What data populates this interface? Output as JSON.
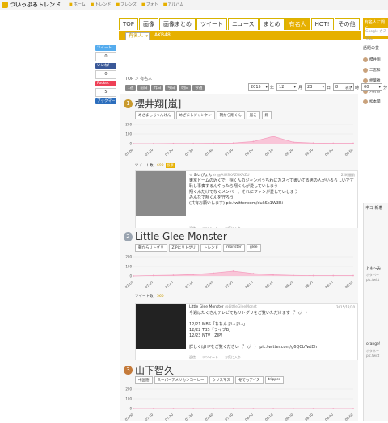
{
  "site": {
    "logo": "ついっぷるトレンド"
  },
  "top_nav": [
    {
      "icon": "home-icon",
      "label": "ホーム"
    },
    {
      "icon": "trend-icon",
      "label": "トレンド"
    },
    {
      "icon": "friends-icon",
      "label": "フレンズ"
    },
    {
      "icon": "photo-icon",
      "label": "フォト"
    },
    {
      "icon": "album-icon",
      "label": "アルバム"
    }
  ],
  "main_nav": {
    "tabs": [
      "TOP",
      "画像",
      "画像まとめ",
      "ツイート",
      "ニュース",
      "まとめ",
      "有名人",
      "HOT!",
      "その他"
    ],
    "active": "有名人",
    "sub": [
      "有名人",
      "AKB48"
    ]
  },
  "social": {
    "tweet": "ツイート",
    "tweet_count": "0",
    "like": "いいね！",
    "like_count": "0",
    "pocket": "Pocket",
    "pocket_count": "5",
    "bookmark": "ブックマーク"
  },
  "sidebar": {
    "search_title": "有名人に聞く",
    "search_placeholder": "Google カスタム",
    "ranking_title": "話題の芸",
    "ranking": [
      "櫻井翔",
      "二宮和",
      "相葉雅",
      "大野智",
      "松本潤"
    ],
    "news_title": "ネコ 新着",
    "news_users": [
      "とも〜み",
      "orange!"
    ],
    "news_texts": [
      "ボタバー",
      "pic.twitt",
      "ボタネー",
      "pic.twitt"
    ]
  },
  "breadcrumb": "TOP ＞ 有名人",
  "date_buttons": [
    "1週",
    "前日",
    "昨日",
    "今日",
    "明日",
    "今週"
  ],
  "date_select": {
    "year": "2015",
    "year_unit": "年",
    "month": "12",
    "month_unit": "月",
    "day": "23",
    "day_unit": "日",
    "hour": "8",
    "hour_unit": "時",
    "minute": "00",
    "minute_unit": "分",
    "show": "表示"
  },
  "cards": [
    {
      "rank": "1",
      "name": "櫻井翔[嵐]",
      "tags": [
        "めざましじゃんけん",
        "めざましジャンケン",
        "朝から翔くん",
        "嵐こ",
        "翔"
      ],
      "tweet_count_label": "ツイート数：",
      "tweet_count": "690",
      "tweet_count_pill": "投票",
      "tweet": {
        "user": "☆ あいぴょん ☆",
        "handle": "@AIUSKAZUKAZU",
        "date": "22時間前",
        "text": "東京ドームの近くで、翔くんのジャンボうちわにカスって書いてる男の人がいるらしいです\n恥し事奏するんやったら翔くんが愛していしまう\n翔くんだけでなくメンバー、それにファンが愛していしまう\nみんなで翔くんを守ろう\n(共有お願いします) pic.twitter.com/dukSk1W3Ri",
        "acts": [
          "返信",
          "リツイート",
          "お気に入り"
        ]
      }
    },
    {
      "rank": "2",
      "name": "Little Glee Monster",
      "tags": [
        "朝からリトグリ",
        "ZIPにリトグリ",
        "トレンド",
        "monster",
        "glee"
      ],
      "tweet_count_label": "ツイート数：",
      "tweet_count": "560",
      "tweet": {
        "user": "Little Glee Monster",
        "handle": "@LittleGleeMonst",
        "date": "2015/12/20",
        "text": "今週はたくさんテレビでもリトグリをご覧いただけます（゜◇゜）\n\n12/21 MBS「ちちんぷいぷい」\n12/22 TBS「ライブB」\n12/23 NTV「ZIP！」\n\n詳しくはHPをご覧ください（゜◇゜） pic.twitter.com/g6QCbTwtDh",
        "acts": [
          "返信",
          "リツイート",
          "お気に入り"
        ]
      }
    },
    {
      "rank": "3",
      "name": "山下智久",
      "tags": [
        "中国語",
        "スーパーアメリカンコーヒー",
        "クリスマス",
        "冬でもアイス",
        "tripper"
      ]
    }
  ],
  "chart_data": [
    {
      "type": "area",
      "x": [
        "07:00",
        "07:10",
        "07:20",
        "07:30",
        "07:40",
        "07:50",
        "08:00",
        "08:10",
        "08:20",
        "08:30",
        "08:40",
        "08:50"
      ],
      "y": [
        0,
        0,
        2,
        2,
        4,
        6,
        22,
        75,
        15,
        6,
        4,
        4
      ],
      "ylim": [
        0,
        200
      ],
      "yticks": [
        0,
        100,
        200
      ],
      "color": "#f4a0c0",
      "grid": true
    },
    {
      "type": "area",
      "x": [
        "07:00",
        "07:10",
        "07:20",
        "07:30",
        "07:40",
        "07:50",
        "08:00",
        "08:10",
        "08:20",
        "08:30",
        "08:40",
        "08:50"
      ],
      "y": [
        0,
        5,
        8,
        15,
        30,
        50,
        25,
        12,
        6,
        4,
        4,
        4
      ],
      "ylim": [
        0,
        200
      ],
      "yticks": [
        0,
        100,
        200
      ],
      "color": "#f4a0c0",
      "grid": true
    },
    {
      "type": "area",
      "x": [
        "07:00",
        "07:10",
        "07:20",
        "07:30",
        "07:40",
        "07:50",
        "08:00",
        "08:10",
        "08:20",
        "08:30",
        "08:40",
        "08:50"
      ],
      "y": [
        0,
        0,
        0,
        0,
        0,
        0,
        0,
        0,
        0,
        0,
        0,
        0
      ],
      "ylim": [
        0,
        200
      ],
      "yticks": [
        0,
        100,
        200
      ],
      "color": "#f4a0c0",
      "grid": true
    }
  ]
}
